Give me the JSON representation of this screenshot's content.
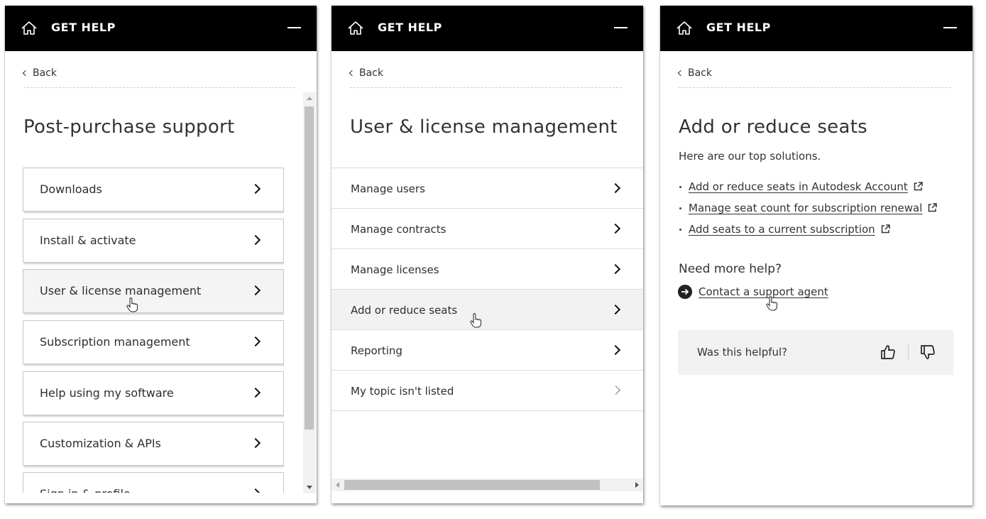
{
  "header": {
    "title": "GET HELP"
  },
  "panel1": {
    "back": "Back",
    "title": "Post-purchase support",
    "cards": [
      "Downloads",
      "Install & activate",
      "User & license management",
      "Subscription management",
      "Help using my software",
      "Customization & APIs",
      "Sign in & profile"
    ]
  },
  "panel2": {
    "back": "Back",
    "title": "User & license management",
    "rows": [
      "Manage users",
      "Manage contracts",
      "Manage licenses",
      "Add or reduce seats",
      "Reporting",
      "My topic isn't listed"
    ]
  },
  "panel3": {
    "back": "Back",
    "title": "Add or reduce seats",
    "subtitle": "Here are our top solutions.",
    "links": [
      "Add or reduce seats in Autodesk Account",
      "Manage seat count for subscription renewal",
      "Add seats to a current subscription"
    ],
    "need_help": "Need more help?",
    "contact": "Contact a support agent",
    "helpful": "Was this helpful?"
  },
  "colors": {
    "header_bg": "#000000",
    "hover_bg": "#f2f2f2",
    "text": "#2e2e2e"
  },
  "icons": [
    "home-icon",
    "minimize-icon",
    "chevron-left-icon",
    "chevron-right-icon",
    "external-link-icon",
    "arrow-circle-right-icon",
    "thumbs-up-icon",
    "thumbs-down-icon",
    "hand-cursor-icon"
  ]
}
